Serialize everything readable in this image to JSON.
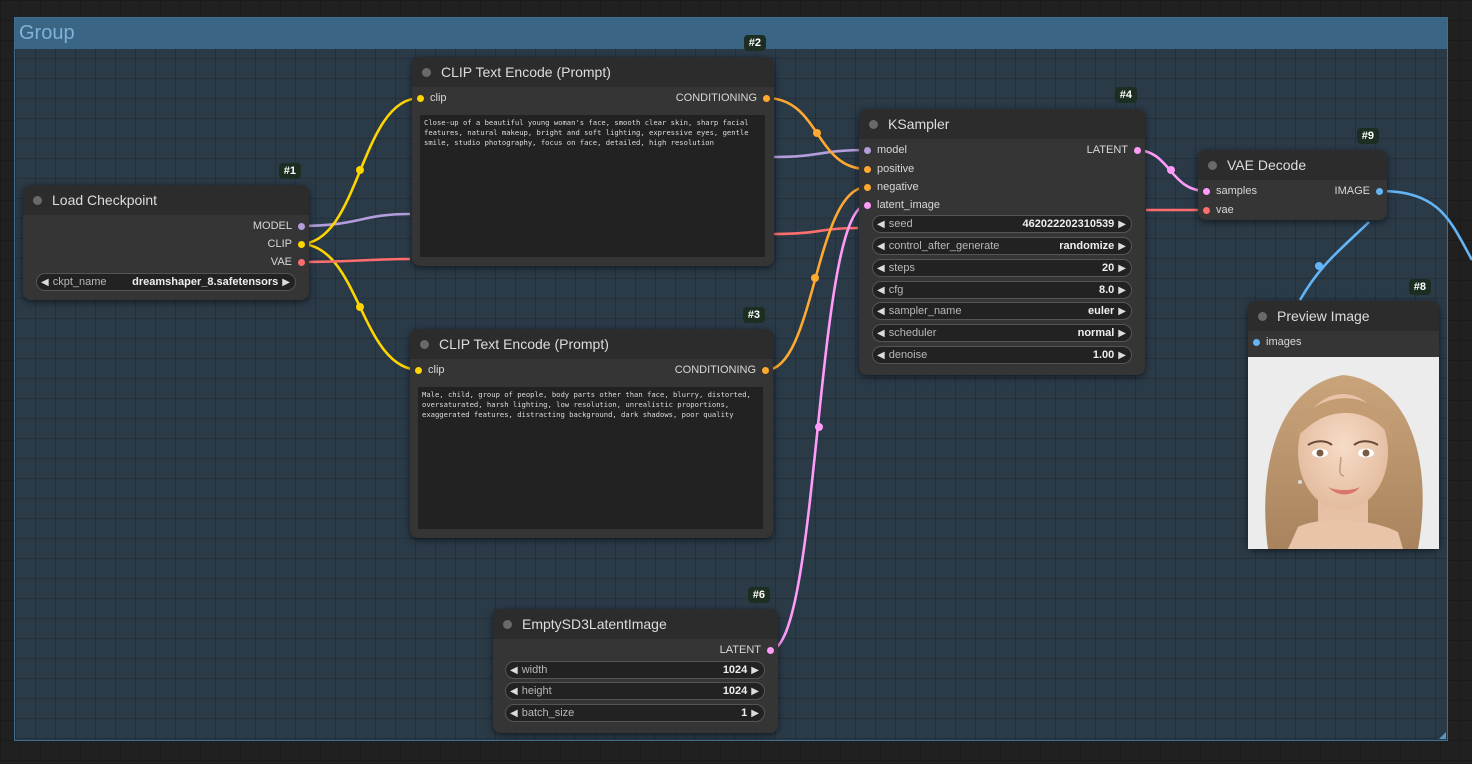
{
  "group": {
    "title": "Group"
  },
  "colors": {
    "model": "#b39ddb",
    "clip": "#ffd500",
    "vae": "#ff6e6e",
    "conditioning": "#ffa931",
    "latent": "#ff9cf9",
    "image": "#64b5f6"
  },
  "nodes": {
    "load_checkpoint": {
      "id": "#1",
      "title": "Load Checkpoint",
      "outputs": [
        "MODEL",
        "CLIP",
        "VAE"
      ],
      "widget": {
        "label": "ckpt_name",
        "value": "dreamshaper_8.safetensors"
      }
    },
    "clip_pos": {
      "id": "#2",
      "title": "CLIP Text Encode (Prompt)",
      "input": "clip",
      "output": "CONDITIONING",
      "text": "Close-up of a beautiful young woman's face, smooth clear skin, sharp facial features, natural makeup, bright and soft lighting, expressive eyes, gentle smile, studio photography, focus on face, detailed, high resolution"
    },
    "clip_neg": {
      "id": "#3",
      "title": "CLIP Text Encode (Prompt)",
      "input": "clip",
      "output": "CONDITIONING",
      "text": "Male, child, group of people, body parts other than face, blurry, distorted, oversaturated, harsh lighting, low resolution, unrealistic proportions, exaggerated features, distracting background, dark shadows, poor quality"
    },
    "ksampler": {
      "id": "#4",
      "title": "KSampler",
      "inputs": [
        "model",
        "positive",
        "negative",
        "latent_image"
      ],
      "output": "LATENT",
      "widgets": [
        {
          "label": "seed",
          "value": "462022202310539"
        },
        {
          "label": "control_after_generate",
          "value": "randomize"
        },
        {
          "label": "steps",
          "value": "20"
        },
        {
          "label": "cfg",
          "value": "8.0"
        },
        {
          "label": "sampler_name",
          "value": "euler"
        },
        {
          "label": "scheduler",
          "value": "normal"
        },
        {
          "label": "denoise",
          "value": "1.00"
        }
      ]
    },
    "empty_latent": {
      "id": "#6",
      "title": "EmptySD3LatentImage",
      "output": "LATENT",
      "widgets": [
        {
          "label": "width",
          "value": "1024"
        },
        {
          "label": "height",
          "value": "1024"
        },
        {
          "label": "batch_size",
          "value": "1"
        }
      ]
    },
    "preview": {
      "id": "#8",
      "title": "Preview Image",
      "input": "images"
    },
    "vae_decode": {
      "id": "#9",
      "title": "VAE Decode",
      "inputs": [
        "samples",
        "vae"
      ],
      "output": "IMAGE"
    }
  }
}
